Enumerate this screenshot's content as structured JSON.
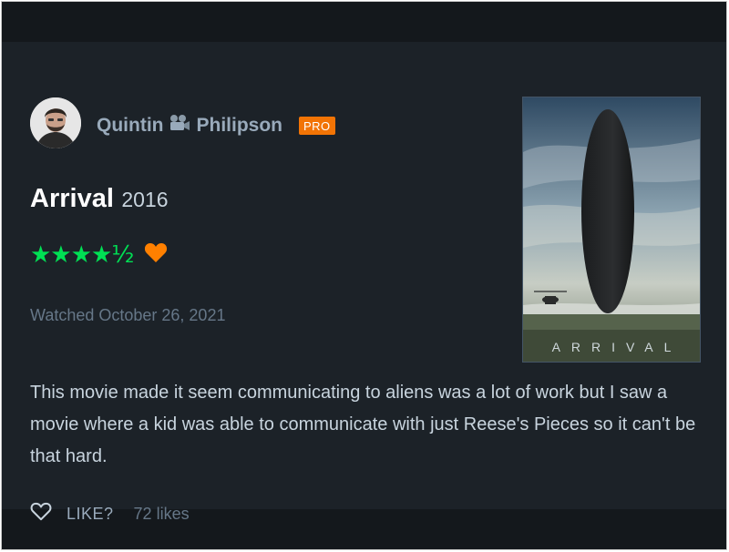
{
  "review": {
    "author": {
      "name_first": "Quintin",
      "name_last": "Philipson",
      "badge": "PRO",
      "badge_color": "#f27405"
    },
    "film": {
      "title": "Arrival",
      "year": "2016",
      "poster_wordmark": "ARRIVAL"
    },
    "rating": {
      "stars_text": "★★★★½",
      "value": 4.5,
      "max": 5,
      "star_color": "#00e054",
      "liked_icon": "heart-icon",
      "liked_color": "#ff8000"
    },
    "watched_text": "Watched October 26, 2021",
    "body": "This movie made it seem communicating to aliens was a lot of work but I saw a movie where a kid was able to communicate with just Reese's Pieces so it can't be that hard.",
    "actions": {
      "like_label": "LIKE?",
      "likes_count": "72 likes",
      "like_icon": "heart-outline-icon"
    }
  }
}
